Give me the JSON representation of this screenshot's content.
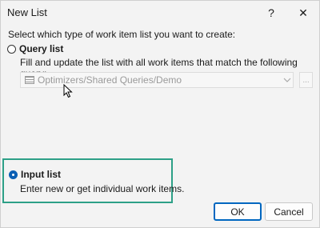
{
  "window": {
    "title": "New List",
    "help_label": "?",
    "close_label": "✕"
  },
  "prompt": "Select which type of work item list you want to create:",
  "query_list": {
    "label": "Query list",
    "selected": false,
    "description": "Fill and update the list with all work items that match the following query:",
    "query_value": "Optimizers/Shared Queries/Demo",
    "browse_label": "...",
    "enabled": false
  },
  "input_list": {
    "label": "Input list",
    "selected": true,
    "description": "Enter new or get individual work items."
  },
  "buttons": {
    "ok_label": "OK",
    "cancel_label": "Cancel"
  },
  "colors": {
    "highlight_border": "#2da087",
    "accent": "#0067c0"
  },
  "icons": {
    "query": "query-list-icon",
    "dropdown": "chevron-down-icon",
    "cursor": "mouse-pointer-icon"
  }
}
